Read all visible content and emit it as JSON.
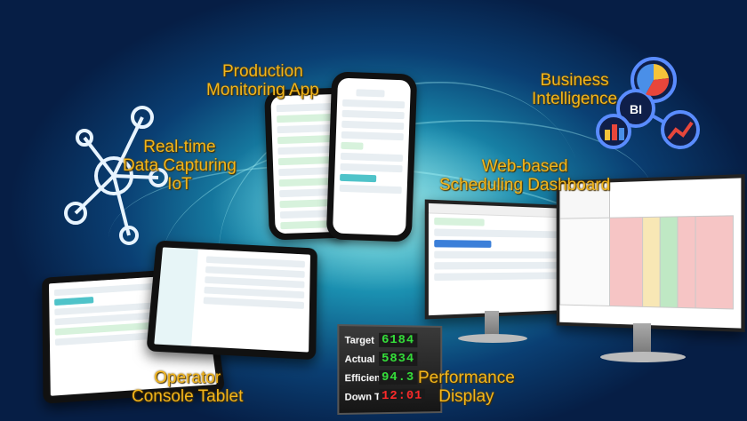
{
  "labels": {
    "production_monitoring": "Production\nMonitoring App",
    "business_intelligence": "Business\nIntelligence",
    "realtime_data": "Real-time\nData Capturing\nIoT",
    "scheduling_dashboard": "Web-based\nScheduling Dashboard",
    "operator_console": "Operator\nConsole Tablet",
    "performance_display": "Performance\nDisplay"
  },
  "bi_badge": "BI",
  "performance_board": {
    "rows": [
      {
        "label": "Target",
        "value": "6184",
        "color": "green"
      },
      {
        "label": "Actual",
        "value": "5834",
        "color": "green"
      },
      {
        "label": "Efficiency",
        "value": "94.3",
        "color": "green"
      },
      {
        "label": "Down Time",
        "value": "12:01",
        "color": "red"
      }
    ]
  },
  "colors": {
    "label_gold": "#f2b51c",
    "background_deep": "#061e45",
    "background_glow": "#4fd3d6"
  }
}
